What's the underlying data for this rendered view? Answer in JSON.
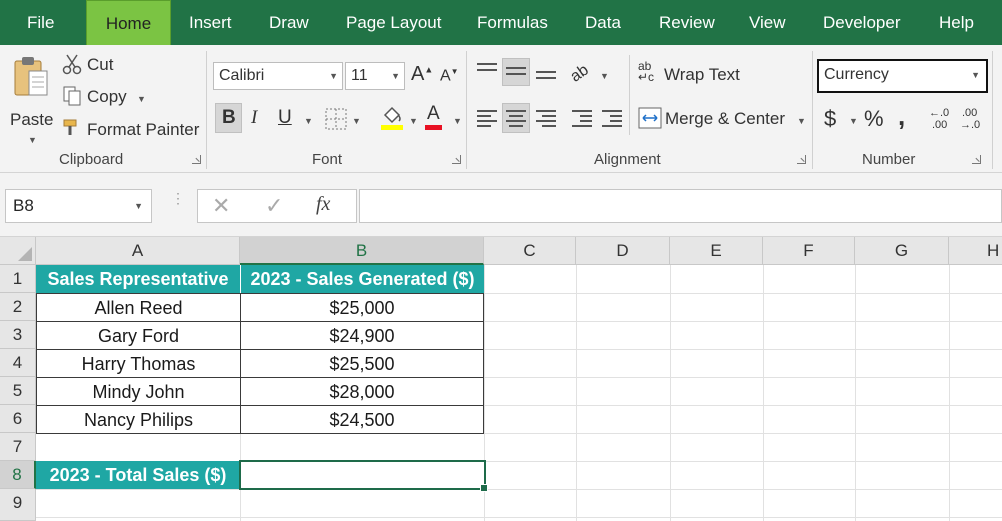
{
  "menu": {
    "tabs": [
      "File",
      "Home",
      "Insert",
      "Draw",
      "Page Layout",
      "Formulas",
      "Data",
      "Review",
      "View",
      "Developer",
      "Help"
    ]
  },
  "ribbon": {
    "clipboard": {
      "paste": "Paste",
      "cut": "Cut",
      "copy": "Copy",
      "format_painter": "Format Painter",
      "group_label": "Clipboard"
    },
    "font": {
      "family": "Calibri",
      "size": "11",
      "bold": "B",
      "italic": "I",
      "underline": "U",
      "increase_size": "A",
      "decrease_size": "A",
      "font_color": "A",
      "group_label": "Font"
    },
    "alignment": {
      "wrap_text": "Wrap Text",
      "merge_center": "Merge & Center",
      "group_label": "Alignment"
    },
    "number": {
      "format": "Currency",
      "currency_symbol": "$",
      "percent_symbol": "%",
      "comma_symbol": ",",
      "increase_decimal_top": "←.0",
      "increase_decimal_bottom": ".00",
      "decrease_decimal_top": ".00",
      "decrease_decimal_bottom": "→.0",
      "group_label": "Number"
    },
    "accent_color": "#217346",
    "active_tab_color": "#7bc443"
  },
  "formula_bar": {
    "name_box": "B8",
    "fx": "fx",
    "formula": ""
  },
  "sheet": {
    "columns": [
      "A",
      "B",
      "C",
      "D",
      "E",
      "F",
      "G",
      "H"
    ],
    "rows": [
      "1",
      "2",
      "3",
      "4",
      "5",
      "6",
      "7",
      "8",
      "9"
    ],
    "header": [
      "Sales Representative",
      "2023 - Sales Generated ($)"
    ],
    "data": [
      [
        "Allen Reed",
        "$25,000"
      ],
      [
        "Gary Ford",
        "$24,900"
      ],
      [
        "Harry Thomas",
        "$25,500"
      ],
      [
        "Mindy John",
        "$28,000"
      ],
      [
        "Nancy Philips",
        "$24,500"
      ]
    ],
    "total_label": "2023 - Total Sales ($)",
    "total_value": "",
    "header_fill": "#1fa7a4",
    "selected_cell": "B8"
  }
}
